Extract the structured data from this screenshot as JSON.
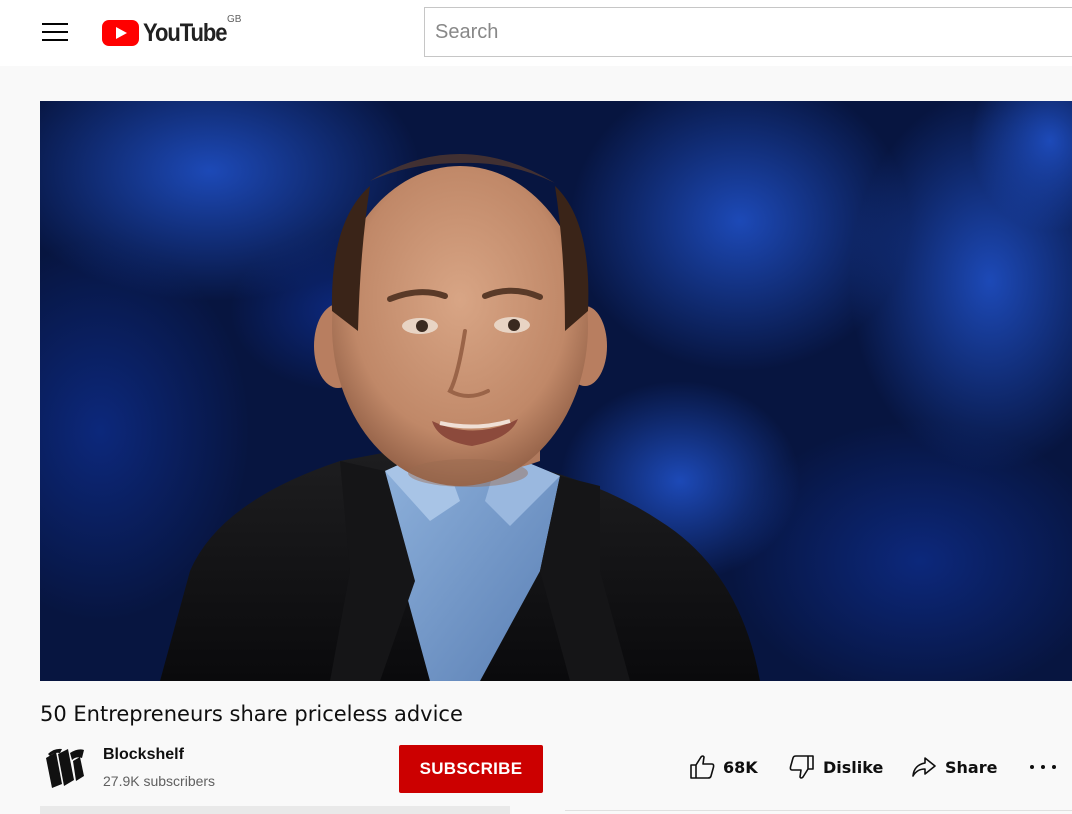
{
  "masthead": {
    "menu_icon": "hamburger-menu-icon",
    "logo_text": "YouTube",
    "country_code": "GB",
    "search_placeholder": "Search"
  },
  "video": {
    "title": "50 Entrepreneurs share priceless advice"
  },
  "channel": {
    "name": "Blockshelf",
    "subscribers": "27.9K subscribers",
    "avatar_icon": "books-logo-icon"
  },
  "actions": {
    "subscribe_label": "SUBSCRIBE",
    "like_count": "68K",
    "dislike_label": "Dislike",
    "share_label": "Share",
    "more_icon": "more-horizontal-icon"
  },
  "colors": {
    "brand_red": "#ff0000",
    "subscribe_red": "#cc0000",
    "page_background": "#f9f9f9"
  }
}
